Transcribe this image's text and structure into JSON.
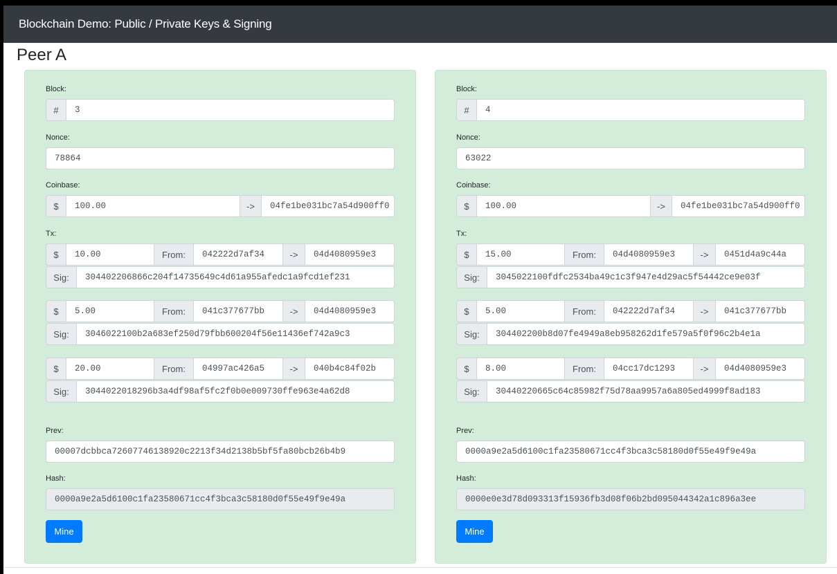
{
  "app": {
    "title": "Blockchain Demo: Public / Private Keys & Signing"
  },
  "peer": {
    "title": "Peer A"
  },
  "labels": {
    "block": "Block:",
    "nonce": "Nonce:",
    "coinbase": "Coinbase:",
    "tx": "Tx:",
    "prev": "Prev:",
    "hash": "Hash:",
    "hash_sym": "#",
    "dollar": "$",
    "arrow": "->",
    "from": "From:",
    "sig": "Sig:",
    "mine": "Mine"
  },
  "blocks": [
    {
      "number": "3",
      "nonce": "78864",
      "coinbase": {
        "amount": "100.00",
        "to": "04fe1be031bc7a54d900ff0"
      },
      "txs": [
        {
          "amount": "10.00",
          "from": "042222d7af34",
          "to": "04d4080959e3",
          "sig": "304402206866c204f14735649c4d61a955afedc1a9fcd1ef231"
        },
        {
          "amount": "5.00",
          "from": "041c377677bb",
          "to": "04d4080959e3",
          "sig": "3046022100b2a683ef250d79fbb600204f56e11436ef742a9c3"
        },
        {
          "amount": "20.00",
          "from": "04997ac426a5",
          "to": "040b4c84f02b",
          "sig": "3044022018296b3a4df98af5fc2f0b0e009730ffe963e4a62d8"
        }
      ],
      "prev": "00007dcbbca72607746138920c2213f34d2138b5bf5fa80bcb26b4b9",
      "hash": "0000a9e2a5d6100c1fa23580671cc4f3bca3c58180d0f55e49f9e49a"
    },
    {
      "number": "4",
      "nonce": "63022",
      "coinbase": {
        "amount": "100.00",
        "to": "04fe1be031bc7a54d900ff0"
      },
      "txs": [
        {
          "amount": "15.00",
          "from": "04d4080959e3",
          "to": "0451d4a9c44a",
          "sig": "3045022100fdfc2534ba49c1c3f947e4d29ac5f54442ce9e03f"
        },
        {
          "amount": "5.00",
          "from": "042222d7af34",
          "to": "041c377677bb",
          "sig": "304402200b8d07fe4949a8eb958262d1fe579a5f0f96c2b4e1a"
        },
        {
          "amount": "8.00",
          "from": "04cc17dc1293",
          "to": "04d4080959e3",
          "sig": "30440220665c64c85982f75d78aa9957a6a805ed4999f8ad183"
        }
      ],
      "prev": "0000a9e2a5d6100c1fa23580671cc4f3bca3c58180d0f55e49f9e49a",
      "hash": "0000e0e3d78d093313f15936fb3d08f06b2bd095044342a1c896a3ee"
    }
  ]
}
